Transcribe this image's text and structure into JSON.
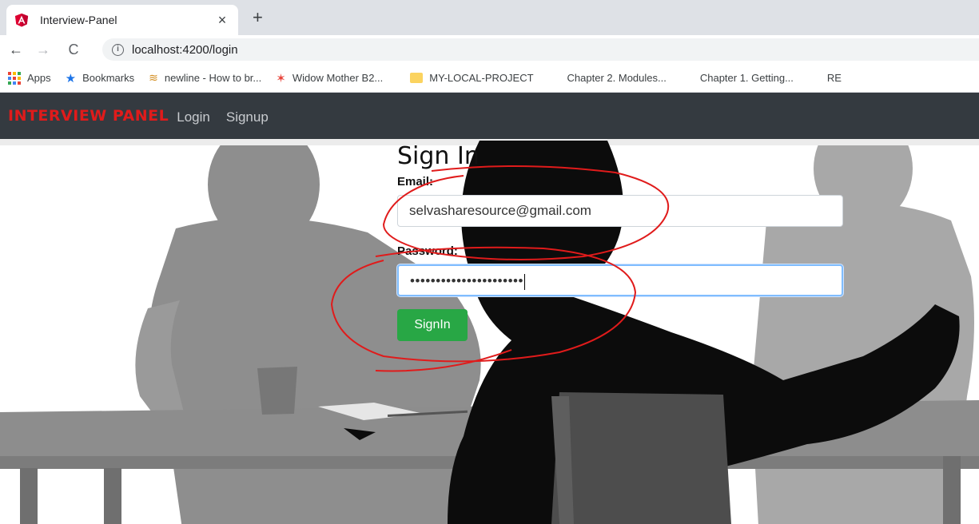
{
  "browser": {
    "tab_title": "Interview-Panel",
    "tab_close": "×",
    "new_tab": "+",
    "url": "localhost:4200/login",
    "info_icon": "i",
    "nav": {
      "back": "←",
      "forward": "→",
      "reload": "C"
    },
    "bookmarks": [
      {
        "label": "Apps",
        "icon": "apps-grid-icon"
      },
      {
        "label": "Bookmarks",
        "icon": "star-icon"
      },
      {
        "label": "newline - How to br...",
        "icon": "stackoverflow-icon"
      },
      {
        "label": "Widow Mother B2...",
        "icon": "burst-icon"
      },
      {
        "label": "MY-LOCAL-PROJECT",
        "icon": "folder-icon"
      },
      {
        "label": "Chapter 2. Modules...",
        "icon": "doc-icon"
      },
      {
        "label": "Chapter 1. Getting...",
        "icon": "doc-icon"
      },
      {
        "label": "RE",
        "icon": "doc-icon"
      }
    ]
  },
  "navbar": {
    "brand": "INTERVIEW PANEL",
    "links": [
      "Login",
      "Signup"
    ]
  },
  "form": {
    "title": "Sign In",
    "email_label": "Email:",
    "email_value": "selvasharesource@gmail.com",
    "password_label": "Password:",
    "password_value": "••••••••••••••••••••••",
    "submit_label": "SignIn"
  },
  "colors": {
    "navbar_bg": "#343a40",
    "brand": "#e01b1b",
    "submit_bg": "#28a745",
    "annotation": "#e01b1b"
  }
}
